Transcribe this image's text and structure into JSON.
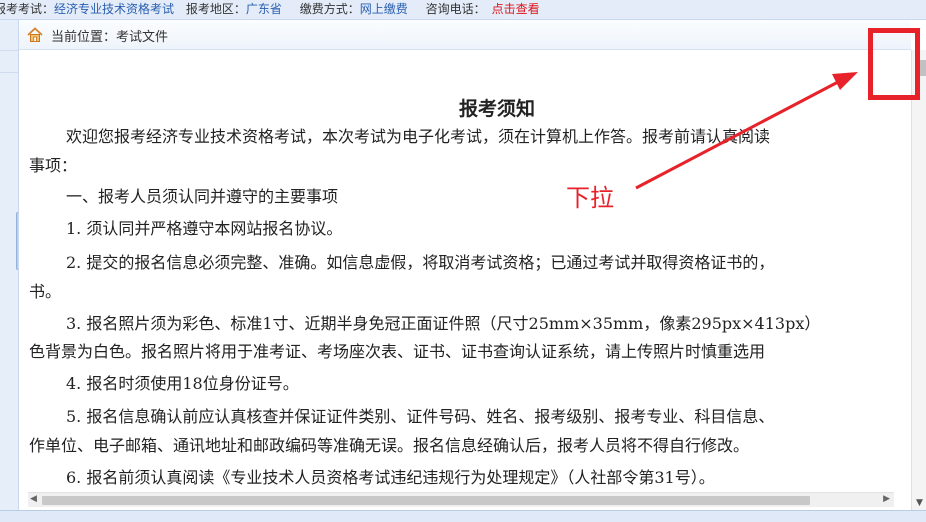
{
  "topbar": {
    "exam_label": "报考考试：",
    "exam_value": "经济专业技术资格考试",
    "region_label": "报考地区：",
    "region_value": "广东省",
    "payment_label": "缴费方式：",
    "payment_value": "网上缴费",
    "phone_label": "咨询电话：",
    "phone_link": "点击查看"
  },
  "breadcrumb": {
    "icon": "home-icon",
    "label": "当前位置：",
    "current": "考试文件"
  },
  "document": {
    "title": "报考须知",
    "lines": [
      "欢迎您报考经济专业技术资格考试，本次考试为电子化考试，须在计算机上作答。报考前请认真阅读",
      "事项：",
      "一、报考人员须认同并遵守的主要事项",
      "1. 须认同并严格遵守本网站报名协议。",
      "2. 提交的报名信息必须完整、准确。如信息虚假，将取消考试资格；已通过考试并取得资格证书的，",
      "书。",
      "3. 报名照片须为彩色、标准1寸、近期半身免冠正面证件照（尺寸25mm×35mm，像素295px×413px）",
      "色背景为白色。报名照片将用于准考证、考场座次表、证书、证书查询认证系统，请上传照片时慎重选用",
      "4. 报名时须使用18位身份证号。",
      "5. 报名信息确认前应认真核查并保证证件类别、证件号码、姓名、报考级别、报考专业、科目信息、",
      "作单位、电子邮箱、通讯地址和邮政编码等准确无误。报名信息经确认后，报考人员将不得自行修改。",
      "6. 报名前须认真阅读《专业技术人员资格考试违纪违规行为处理规定》（人社部令第31号）。"
    ]
  },
  "annotation": {
    "label": "下拉",
    "color": "#e8222a"
  },
  "colors": {
    "link_blue": "#2a5fb0",
    "link_red": "#e0141a",
    "bar_bg": "#e3ecf8"
  }
}
